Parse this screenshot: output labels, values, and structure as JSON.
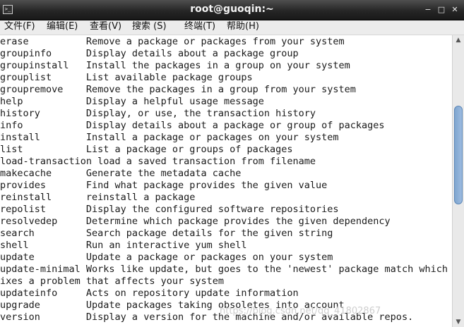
{
  "window": {
    "title": "root@guoqin:~",
    "icon": "terminal-icon",
    "buttons": {
      "minimize": "−",
      "maximize": "□",
      "close": "✕"
    }
  },
  "menu": [
    {
      "label": "文件(F)"
    },
    {
      "label": "编辑(E)"
    },
    {
      "label": "查看(V)"
    },
    {
      "label": "搜索 (S)"
    },
    {
      "label": "终端(T)"
    },
    {
      "label": "帮助(H)"
    }
  ],
  "terminal": {
    "lines": [
      "erase          Remove a package or packages from your system",
      "groupinfo      Display details about a package group",
      "groupinstall   Install the packages in a group on your system",
      "grouplist      List available package groups",
      "groupremove    Remove the packages in a group from your system",
      "help           Display a helpful usage message",
      "history        Display, or use, the transaction history",
      "info           Display details about a package or group of packages",
      "install        Install a package or packages on your system",
      "list           List a package or groups of packages",
      "load-transaction load a saved transaction from filename",
      "makecache      Generate the metadata cache",
      "provides       Find what package provides the given value",
      "reinstall      reinstall a package",
      "repolist       Display the configured software repositories",
      "resolvedep     Determine which package provides the given dependency",
      "search         Search package details for the given string",
      "shell          Run an interactive yum shell",
      "update         Update a package or packages on your system",
      "update-minimal Works like update, but goes to the 'newest' package match which f",
      "ixes a problem that affects your system",
      "updateinfo     Acts on repository update information",
      "upgrade        Update packages taking obsoletes into account",
      "version        Display a version for the machine and/or available repos."
    ],
    "watermark": "https://blog.csdn.net/qq_41802867"
  },
  "scrollbar": {
    "position_fraction": 0.35,
    "up": "▲",
    "down": "▼"
  }
}
